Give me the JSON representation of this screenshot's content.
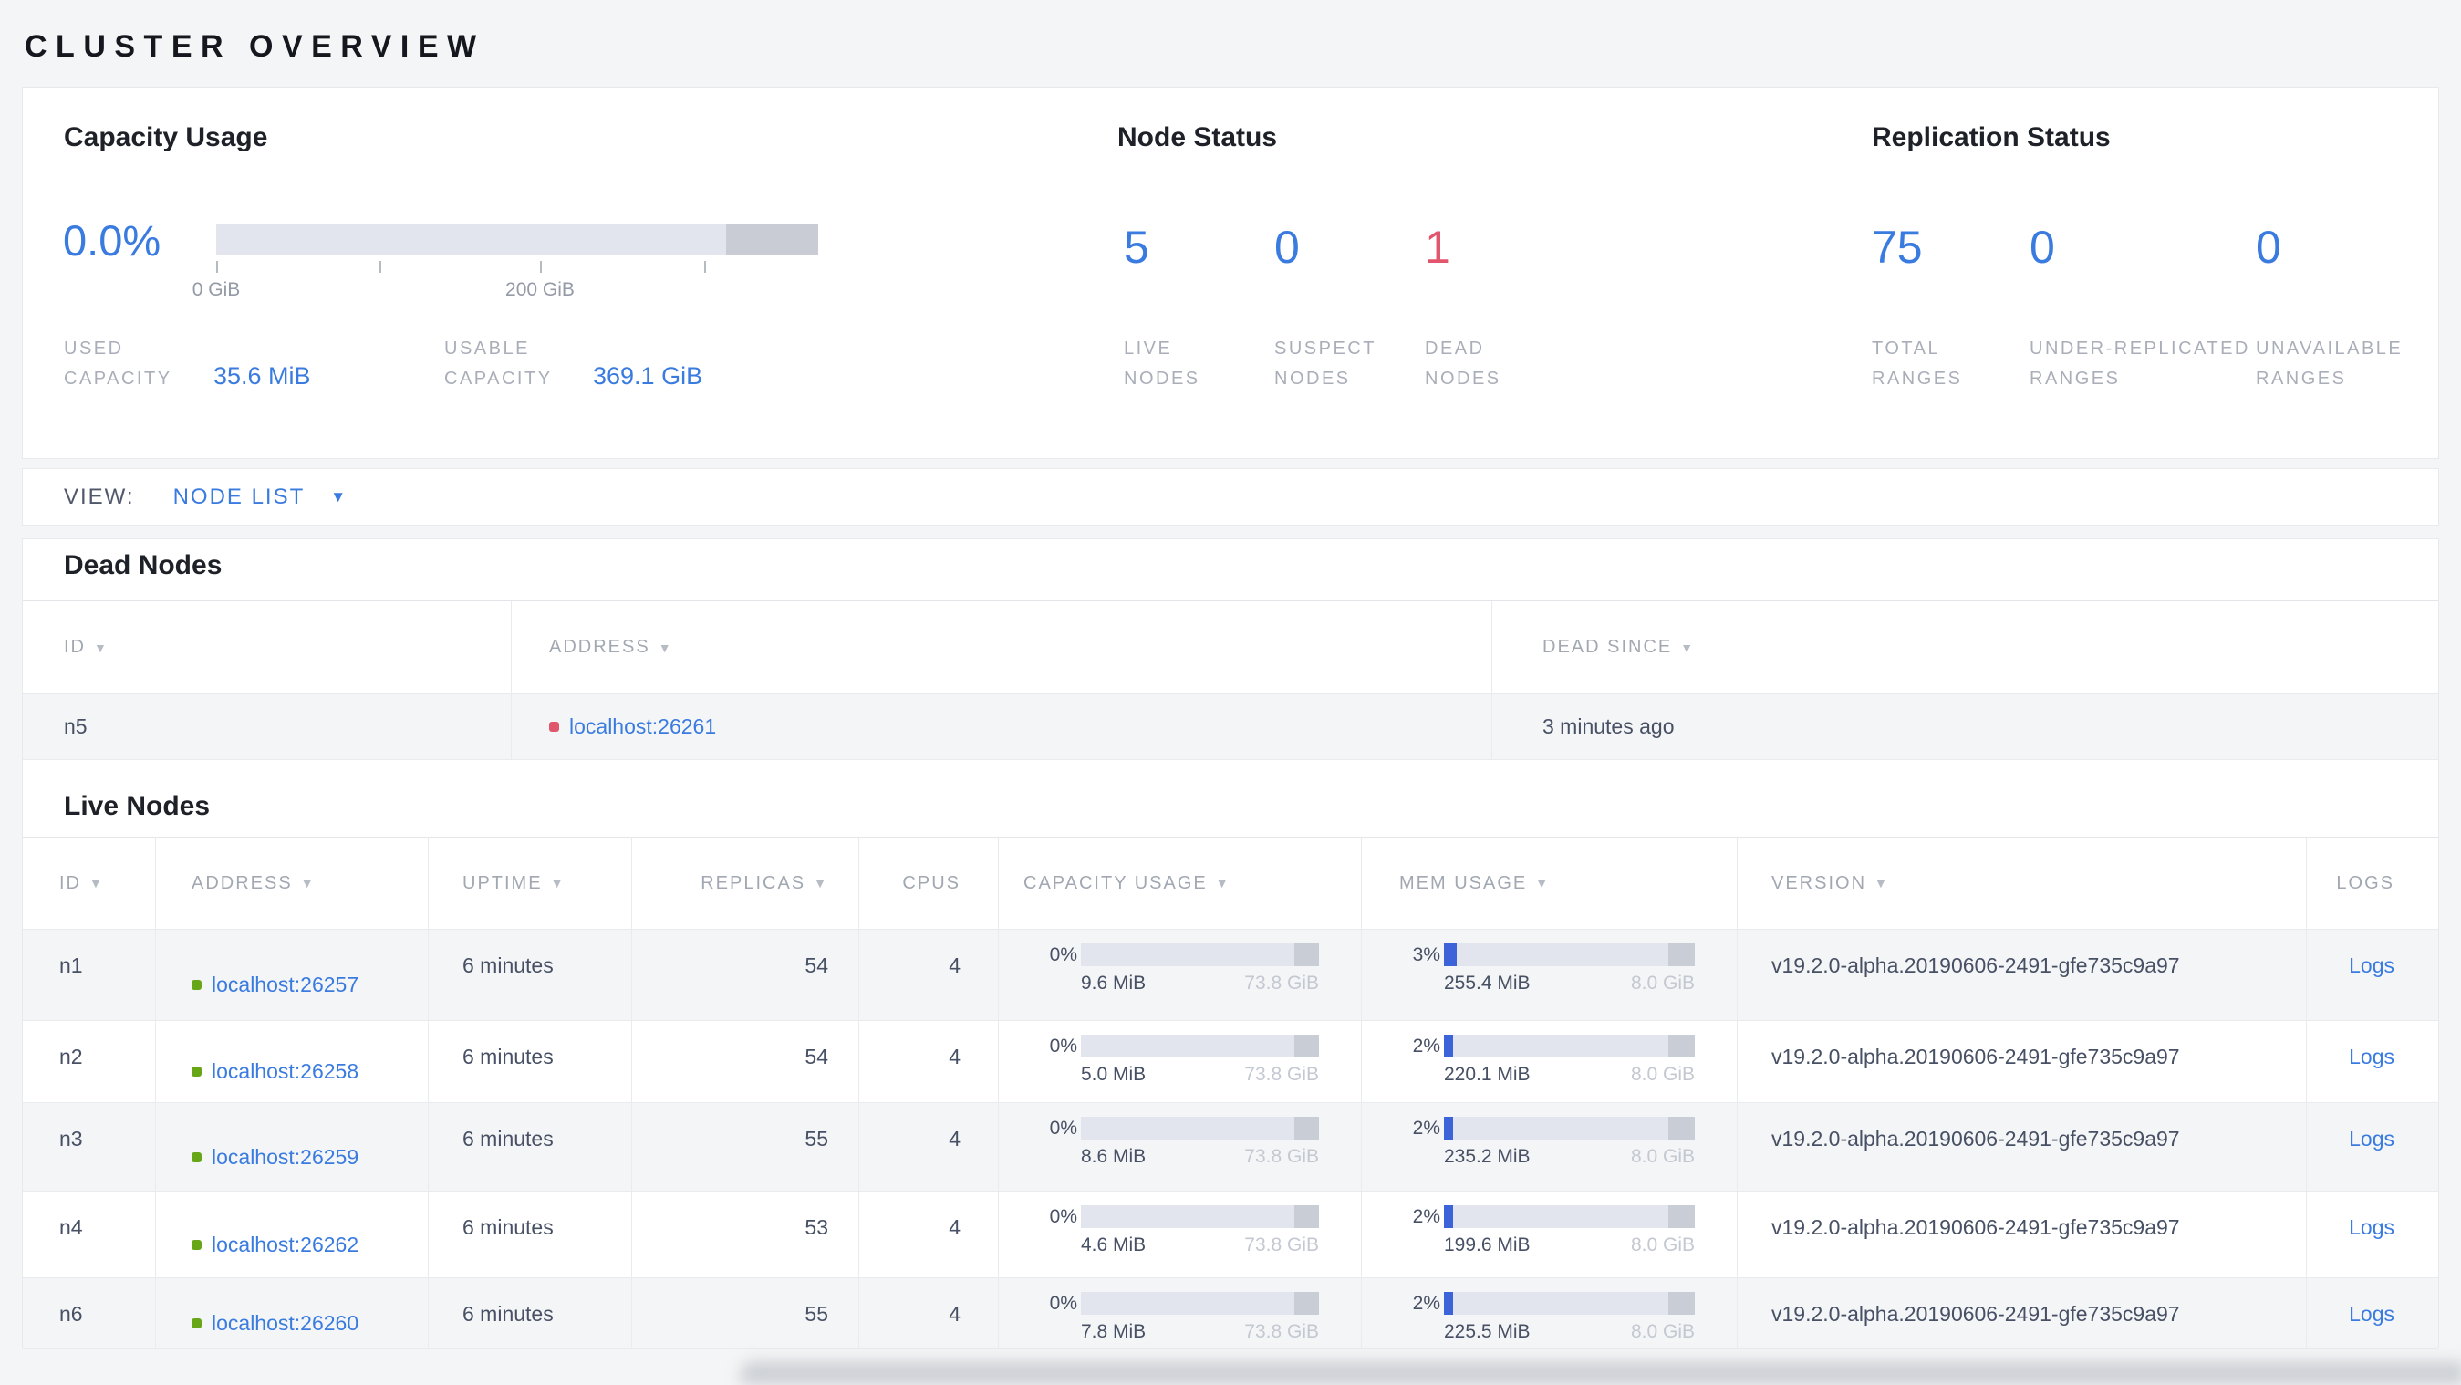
{
  "page": {
    "title": "CLUSTER OVERVIEW"
  },
  "colors": {
    "accent_blue": "#3a7be0",
    "danger_red": "#e2566d",
    "live_green": "#67a617",
    "bar_track": "#e2e4ee",
    "bar_cap_gray": "#c9cdd6",
    "mem_used_blue": "#3c63d8"
  },
  "icons": {
    "sort_desc": "▼",
    "dropdown_caret": "▼"
  },
  "summary": {
    "capacity": {
      "title": "Capacity Usage",
      "percent": "0.0%",
      "gauge_ticks": [
        "0 GiB",
        "200 GiB"
      ],
      "stats": [
        {
          "label": "USED CAPACITY",
          "value": "35.6 MiB"
        },
        {
          "label": "USABLE CAPACITY",
          "value": "369.1 GiB"
        }
      ]
    },
    "node_status": {
      "title": "Node Status",
      "stats": [
        {
          "value": "5",
          "label": "LIVE NODES",
          "state": "live"
        },
        {
          "value": "0",
          "label": "SUSPECT NODES",
          "state": "suspect"
        },
        {
          "value": "1",
          "label": "DEAD NODES",
          "state": "dead"
        }
      ]
    },
    "replication": {
      "title": "Replication Status",
      "stats": [
        {
          "value": "75",
          "label": "TOTAL RANGES"
        },
        {
          "value": "0",
          "label": "UNDER-REPLICATED RANGES"
        },
        {
          "value": "0",
          "label": "UNAVAILABLE RANGES"
        }
      ]
    }
  },
  "view_bar": {
    "label": "VIEW:",
    "selected": "NODE LIST"
  },
  "dead_nodes": {
    "title": "Dead Nodes",
    "columns": [
      {
        "label": "ID",
        "sortable": true
      },
      {
        "label": "ADDRESS",
        "sortable": true
      },
      {
        "label": "DEAD SINCE",
        "sortable": true
      }
    ],
    "rows": [
      {
        "id": "n5",
        "address": "localhost:26261",
        "dead_since": "3 minutes ago"
      }
    ]
  },
  "live_nodes": {
    "title": "Live Nodes",
    "columns": [
      {
        "label": "ID",
        "sortable": true
      },
      {
        "label": "ADDRESS",
        "sortable": true
      },
      {
        "label": "UPTIME",
        "sortable": true
      },
      {
        "label": "REPLICAS",
        "sortable": true
      },
      {
        "label": "CPUS",
        "sortable": false
      },
      {
        "label": "CAPACITY USAGE",
        "sortable": true
      },
      {
        "label": "MEM USAGE",
        "sortable": true
      },
      {
        "label": "VERSION",
        "sortable": true
      },
      {
        "label": "LOGS",
        "sortable": false
      }
    ],
    "logs_label": "Logs",
    "rows": [
      {
        "id": "n1",
        "address": "localhost:26257",
        "uptime": "6 minutes",
        "replicas": "54",
        "cpus": "4",
        "capacity": {
          "percent": "0%",
          "used": "9.6 MiB",
          "total": "73.8 GiB",
          "fill_pct": 0
        },
        "memory": {
          "percent": "3%",
          "used": "255.4 MiB",
          "total": "8.0 GiB",
          "fill_pct": 5
        },
        "version": "v19.2.0-alpha.20190606-2491-gfe735c9a97"
      },
      {
        "id": "n2",
        "address": "localhost:26258",
        "uptime": "6 minutes",
        "replicas": "54",
        "cpus": "4",
        "capacity": {
          "percent": "0%",
          "used": "5.0 MiB",
          "total": "73.8 GiB",
          "fill_pct": 0
        },
        "memory": {
          "percent": "2%",
          "used": "220.1 MiB",
          "total": "8.0 GiB",
          "fill_pct": 3.5
        },
        "version": "v19.2.0-alpha.20190606-2491-gfe735c9a97"
      },
      {
        "id": "n3",
        "address": "localhost:26259",
        "uptime": "6 minutes",
        "replicas": "55",
        "cpus": "4",
        "capacity": {
          "percent": "0%",
          "used": "8.6 MiB",
          "total": "73.8 GiB",
          "fill_pct": 0
        },
        "memory": {
          "percent": "2%",
          "used": "235.2 MiB",
          "total": "8.0 GiB",
          "fill_pct": 3.5
        },
        "version": "v19.2.0-alpha.20190606-2491-gfe735c9a97"
      },
      {
        "id": "n4",
        "address": "localhost:26262",
        "uptime": "6 minutes",
        "replicas": "53",
        "cpus": "4",
        "capacity": {
          "percent": "0%",
          "used": "4.6 MiB",
          "total": "73.8 GiB",
          "fill_pct": 0
        },
        "memory": {
          "percent": "2%",
          "used": "199.6 MiB",
          "total": "8.0 GiB",
          "fill_pct": 3.5
        },
        "version": "v19.2.0-alpha.20190606-2491-gfe735c9a97"
      },
      {
        "id": "n6",
        "address": "localhost:26260",
        "uptime": "6 minutes",
        "replicas": "55",
        "cpus": "4",
        "capacity": {
          "percent": "0%",
          "used": "7.8 MiB",
          "total": "73.8 GiB",
          "fill_pct": 0
        },
        "memory": {
          "percent": "2%",
          "used": "225.5 MiB",
          "total": "8.0 GiB",
          "fill_pct": 3.5
        },
        "version": "v19.2.0-alpha.20190606-2491-gfe735c9a97"
      }
    ]
  }
}
